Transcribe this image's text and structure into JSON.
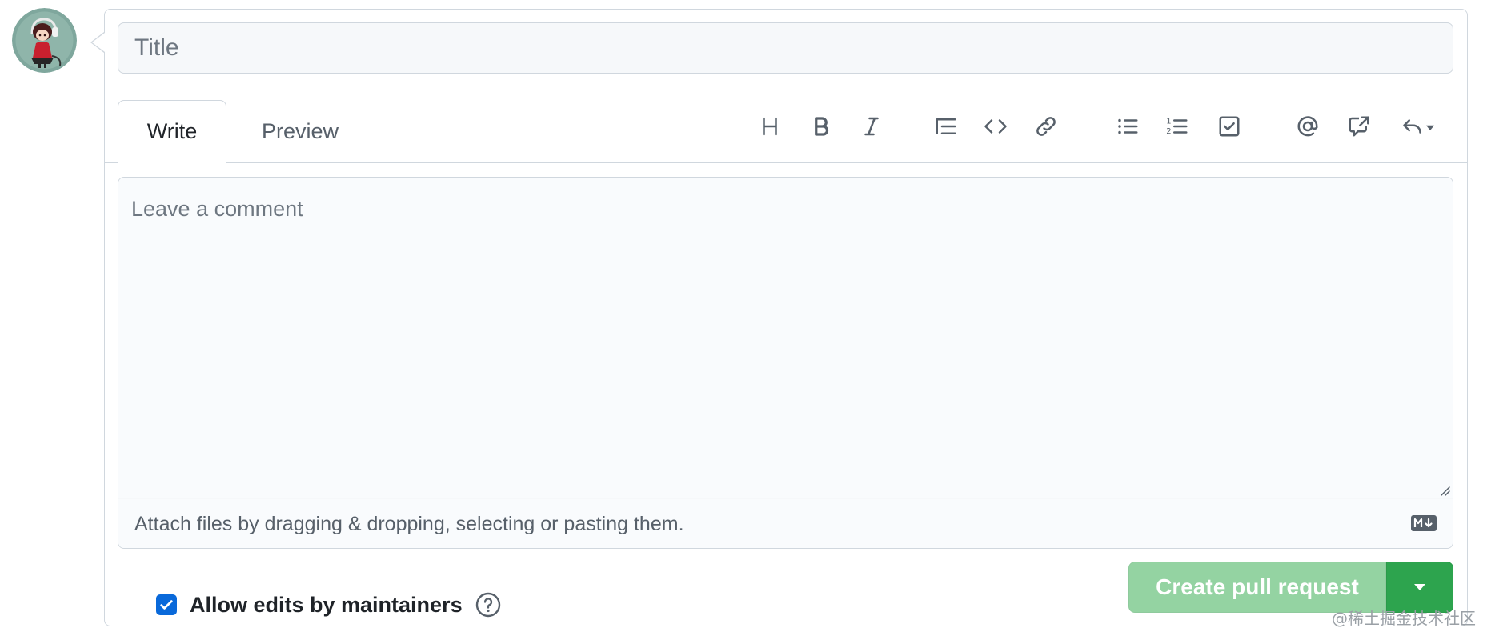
{
  "title_field": {
    "value": "",
    "placeholder": "Title"
  },
  "tabs": [
    {
      "label": "Write",
      "active": true
    },
    {
      "label": "Preview",
      "active": false
    }
  ],
  "toolbar": [
    {
      "icon": "heading-icon"
    },
    {
      "icon": "bold-icon"
    },
    {
      "icon": "italic-icon"
    },
    {
      "icon": "quote-icon"
    },
    {
      "icon": "code-icon"
    },
    {
      "icon": "link-icon"
    },
    {
      "icon": "bulleted-list-icon"
    },
    {
      "icon": "numbered-list-icon"
    },
    {
      "icon": "task-list-icon"
    },
    {
      "icon": "mention-icon"
    },
    {
      "icon": "cross-reference-icon"
    },
    {
      "icon": "saved-replies-icon"
    }
  ],
  "comment": {
    "value": "",
    "placeholder": "Leave a comment",
    "attach_hint": "Attach files by dragging & dropping, selecting or pasting them."
  },
  "maintainers": {
    "label": "Allow edits by maintainers",
    "checked": true
  },
  "submit": {
    "label": "Create pull request"
  },
  "watermark": "@稀土掘金技术社区",
  "colors": {
    "accent_blue": "#0969da",
    "submit_disabled": "#94d3a2",
    "submit_dropdown": "#2da44e",
    "border": "#d0d7de",
    "muted_text": "#57606a"
  }
}
